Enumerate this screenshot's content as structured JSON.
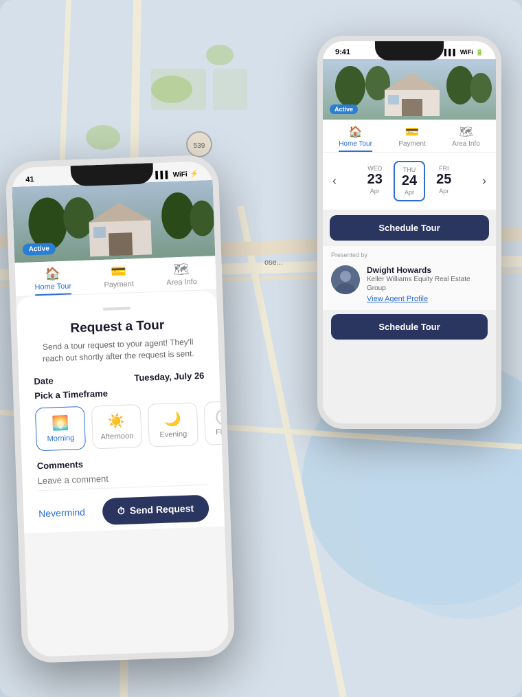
{
  "map": {
    "bg_color": "#cfd8e3",
    "road_color": "#e8e0d0"
  },
  "phone_right": {
    "status_bar": {
      "time": "9:41",
      "signal": "●●●",
      "wifi": "WiFi",
      "battery": "🔋"
    },
    "active_badge": "Active",
    "tabs": [
      {
        "label": "Home Tour",
        "icon": "🏠",
        "active": true
      },
      {
        "label": "Payment",
        "icon": "💳",
        "active": false
      },
      {
        "label": "Area Info",
        "icon": "🗺",
        "active": false
      }
    ],
    "calendar": {
      "nav_left": "‹",
      "nav_right": "›",
      "days": [
        {
          "name": "WED",
          "num": "23",
          "month": "Apr",
          "selected": false
        },
        {
          "name": "THU",
          "num": "24",
          "month": "Apr",
          "selected": true
        },
        {
          "name": "FRI",
          "num": "25",
          "month": "Apr",
          "selected": false
        }
      ]
    },
    "schedule_btn_label": "Schedule Tour",
    "presented_by": "Presented by",
    "agent": {
      "name": "Dwight Howards",
      "company": "Keller Williams Equity Real Estate Group",
      "view_profile": "View Agent Profile"
    },
    "schedule_btn2_label": "Schedule Tour"
  },
  "phone_left": {
    "status_bar": {
      "time": "41",
      "signal": "●●●",
      "wifi": "WiFi",
      "battery": "⚡"
    },
    "active_badge": "Active",
    "tabs": [
      {
        "label": "Home Tour",
        "icon": "🏠",
        "active": true
      },
      {
        "label": "Payment",
        "icon": "💳",
        "active": false
      },
      {
        "label": "Area Info",
        "icon": "🗺",
        "active": false
      }
    ],
    "modal": {
      "handle": "",
      "title": "Request a Tour",
      "description": "Send a tour request to your agent! They'll reach out shortly after the request is sent.",
      "date_label": "Date",
      "date_value": "Tuesday, July 26",
      "timeframe_label": "Pick a Timeframe",
      "timeframe_options": [
        {
          "label": "Morning",
          "icon": "🌅",
          "selected": true
        },
        {
          "label": "Afternoon",
          "icon": "☀️",
          "selected": false
        },
        {
          "label": "Evening",
          "icon": "🌙",
          "selected": false
        },
        {
          "label": "Flexit",
          "icon": "○",
          "selected": false
        }
      ],
      "comments_label": "Comments",
      "comments_placeholder": "Leave a comment",
      "nevermind_label": "Nevermind",
      "send_btn_label": "Send Request",
      "send_icon": "⏱"
    }
  }
}
